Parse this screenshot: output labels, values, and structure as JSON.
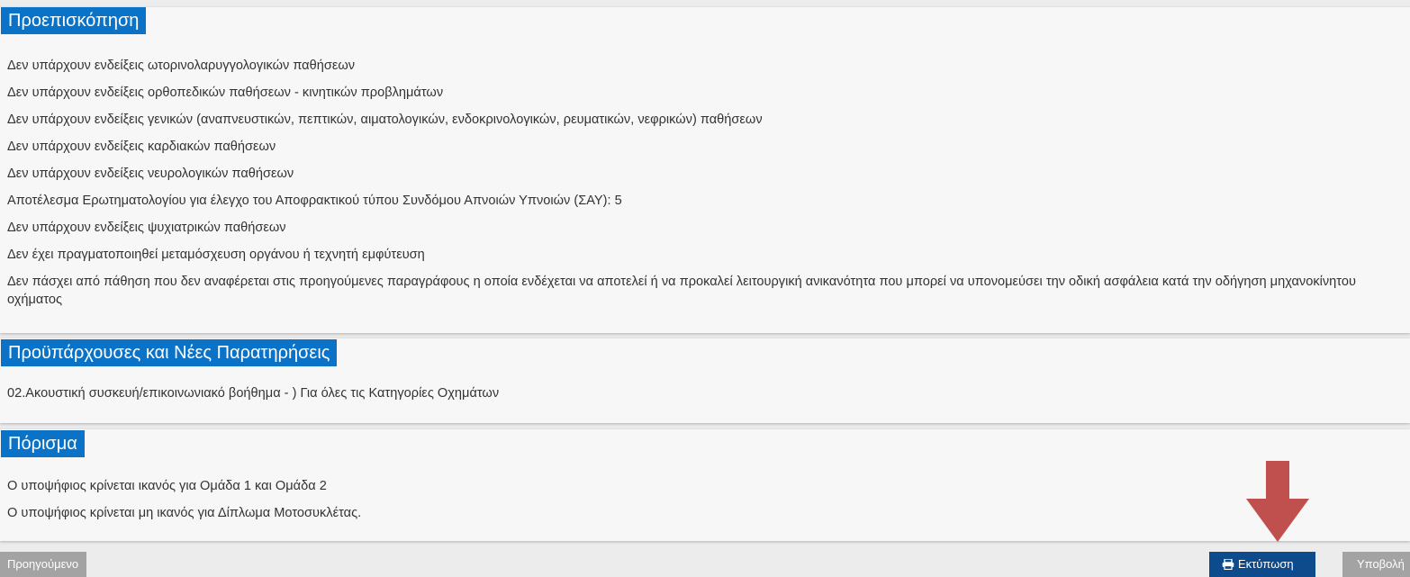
{
  "sections": {
    "preview": {
      "title": "Προεπισκόπηση",
      "lines": [
        "Δεν υπάρχουν ενδείξεις ωτορινολαρυγγολογικών παθήσεων",
        "Δεν υπάρχουν ενδείξεις ορθοπεδικών παθήσεων - κινητικών προβλημάτων",
        "Δεν υπάρχουν ενδείξεις γενικών (αναπνευστικών, πεπτικών, αιματολογικών, ενδοκρινολογικών, ρευματικών, νεφρικών) παθήσεων",
        "Δεν υπάρχουν ενδείξεις καρδιακών παθήσεων",
        "Δεν υπάρχουν ενδείξεις νευρολογικών παθήσεων",
        "Αποτέλεσμα Ερωτηματολογίου για έλεγχο του Αποφρακτικού τύπου Συνδόμου Απνοιών Υπνοιών (ΣΑΥ): 5",
        "Δεν υπάρχουν ενδείξεις ψυχιατρικών παθήσεων",
        "Δεν έχει πραγματοποιηθεί μεταμόσχευση οργάνου ή τεχνητή εμφύτευση",
        "Δεν πάσχει από πάθηση που δεν αναφέρεται στις προηγούμενες παραγράφους η οποία ενδέχεται να αποτελεί ή να προκαλεί λειτουργική ανικανότητα που μπορεί να υπονομεύσει την οδική ασφάλεια κατά την οδήγηση μηχανοκίνητου οχήματος"
      ]
    },
    "observations": {
      "title": "Προϋπάρχουσες και Νέες Παρατηρήσεις",
      "lines": [
        "02.Ακουστική συσκευή/επικοινωνιακό βοήθημα - ) Για όλες τις Κατηγορίες Οχημάτων"
      ]
    },
    "conclusion": {
      "title": "Πόρισμα",
      "lines": [
        "Ο υποψήφιος κρίνεται ικανός για Ομάδα 1 και Ομάδα 2",
        "Ο υποψήφιος κρίνεται μη ικανός για Δίπλωμα Μοτοσυκλέτας."
      ]
    }
  },
  "buttons": {
    "previous": "Προηγούμενο",
    "print": "Εκτύπωση",
    "submit": "Υποβολή"
  },
  "icons": {
    "print": "printer-icon",
    "annotation": "arrow-down-icon"
  },
  "colors": {
    "header_bg": "#0a72c7",
    "print_button": "#0d4b8c",
    "disabled_button": "#a3a3a3",
    "annotation_arrow": "#c0504d"
  }
}
